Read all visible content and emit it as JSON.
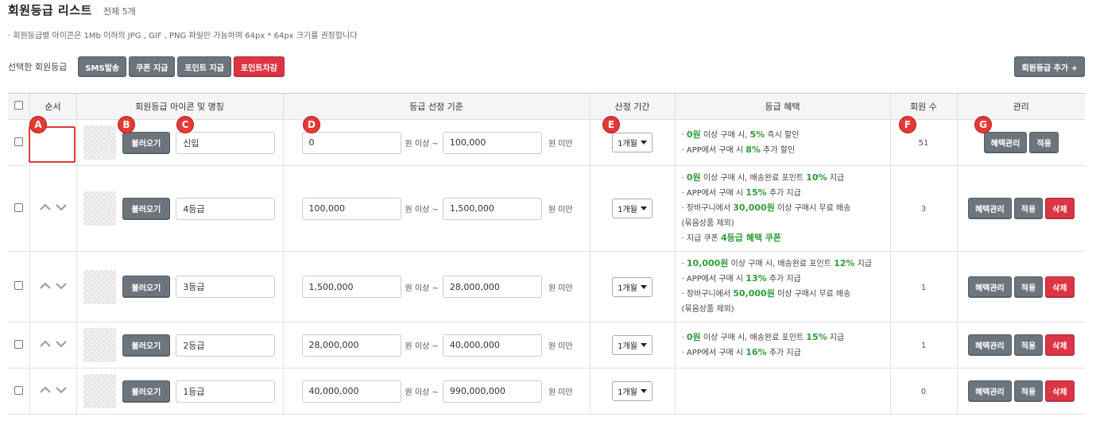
{
  "page": {
    "title": "회원등급 리스트",
    "total": "전체 5개",
    "notice": "· 회원등급별 아이콘은 1Mb 이하의 JPG , GIF , PNG 파일만 가능하며 64px * 64px 크기를 권장합니다"
  },
  "toolbar": {
    "selected_label": "선택한 회원등급",
    "sms": "SMS발송",
    "coupon": "쿠폰 지급",
    "point_give": "포인트 지급",
    "point_deduct": "포인트차감",
    "add_grade": "회원등급 추가 +"
  },
  "table": {
    "headers": {
      "order": "순서",
      "icon_name": "회원등급 아이콘 및 명칭",
      "criteria": "등급 선정 기준",
      "period": "산정 기간",
      "benefits": "등급 혜택",
      "members": "회원 수",
      "manage": "관리"
    },
    "labels": {
      "load": "불러오기",
      "above": "원 이상 ~",
      "below": "원 미만",
      "benefit_btn": "혜택관리",
      "apply_btn": "적용",
      "delete_btn": "삭제"
    },
    "rows": [
      {
        "name": "신입",
        "min": "0",
        "max": "100,000",
        "period": "1개월",
        "count": "51",
        "benefits": [
          {
            "pre": "· ",
            "hl": "0원",
            "post": " 이상 구매 시, ",
            "hl2": "5%",
            "post2": " 즉시 할인"
          },
          {
            "pre": "· APP에서 구매 시 ",
            "hl": "8%",
            "post": " 추가 할인",
            "hl2": "",
            "post2": ""
          }
        ]
      },
      {
        "name": "4등급",
        "min": "100,000",
        "max": "1,500,000",
        "period": "1개월",
        "count": "3",
        "benefits": [
          {
            "pre": "· ",
            "hl": "0원",
            "post": " 이상 구매 시, 배송완료 포인트 ",
            "hl2": "10%",
            "post2": " 지급"
          },
          {
            "pre": "· APP에서 구매 시 ",
            "hl": "15%",
            "post": " 추가 지급",
            "hl2": "",
            "post2": ""
          },
          {
            "pre": "· 장바구니에서 ",
            "hl": "30,000원",
            "post": " 이상 구매시 무료 배송",
            "hl2": "",
            "post2": ""
          },
          {
            "pre": "(묶음상품 제외)",
            "hl": "",
            "post": "",
            "hl2": "",
            "post2": ""
          },
          {
            "pre": "· 지급 쿠폰 ",
            "hl": "4등급 혜택 쿠폰",
            "post": "",
            "hl2": "",
            "post2": ""
          }
        ]
      },
      {
        "name": "3등급",
        "min": "1,500,000",
        "max": "28,000,000",
        "period": "1개월",
        "count": "1",
        "benefits": [
          {
            "pre": "· ",
            "hl": "10,000원",
            "post": " 이상 구매 시, 배송완료 포인트 ",
            "hl2": "12%",
            "post2": " 지급"
          },
          {
            "pre": "· APP에서 구매 시 ",
            "hl": "13%",
            "post": " 추가 지급",
            "hl2": "",
            "post2": ""
          },
          {
            "pre": "· 장바구니에서 ",
            "hl": "50,000원",
            "post": " 이상 구매시 무료 배송",
            "hl2": "",
            "post2": ""
          },
          {
            "pre": "(묶음상품 제외)",
            "hl": "",
            "post": "",
            "hl2": "",
            "post2": ""
          }
        ]
      },
      {
        "name": "2등급",
        "min": "28,000,000",
        "max": "40,000,000",
        "period": "1개월",
        "count": "1",
        "benefits": [
          {
            "pre": "· ",
            "hl": "0원",
            "post": " 이상 구매 시, 배송완료 포인트 ",
            "hl2": "15%",
            "post2": " 지급"
          },
          {
            "pre": "· APP에서 구매 시 ",
            "hl": "16%",
            "post": " 추가 지급",
            "hl2": "",
            "post2": ""
          }
        ]
      },
      {
        "name": "1등급",
        "min": "40,000,000",
        "max": "990,000,000",
        "period": "1개월",
        "count": "0",
        "benefits": []
      }
    ]
  },
  "markers": [
    "A",
    "B",
    "C",
    "D",
    "E",
    "F",
    "G"
  ],
  "colors": {
    "marker": "#e53935",
    "highlight_green": "#2e9e3a",
    "button_gray": "#6c757d",
    "button_red": "#dc3545"
  }
}
